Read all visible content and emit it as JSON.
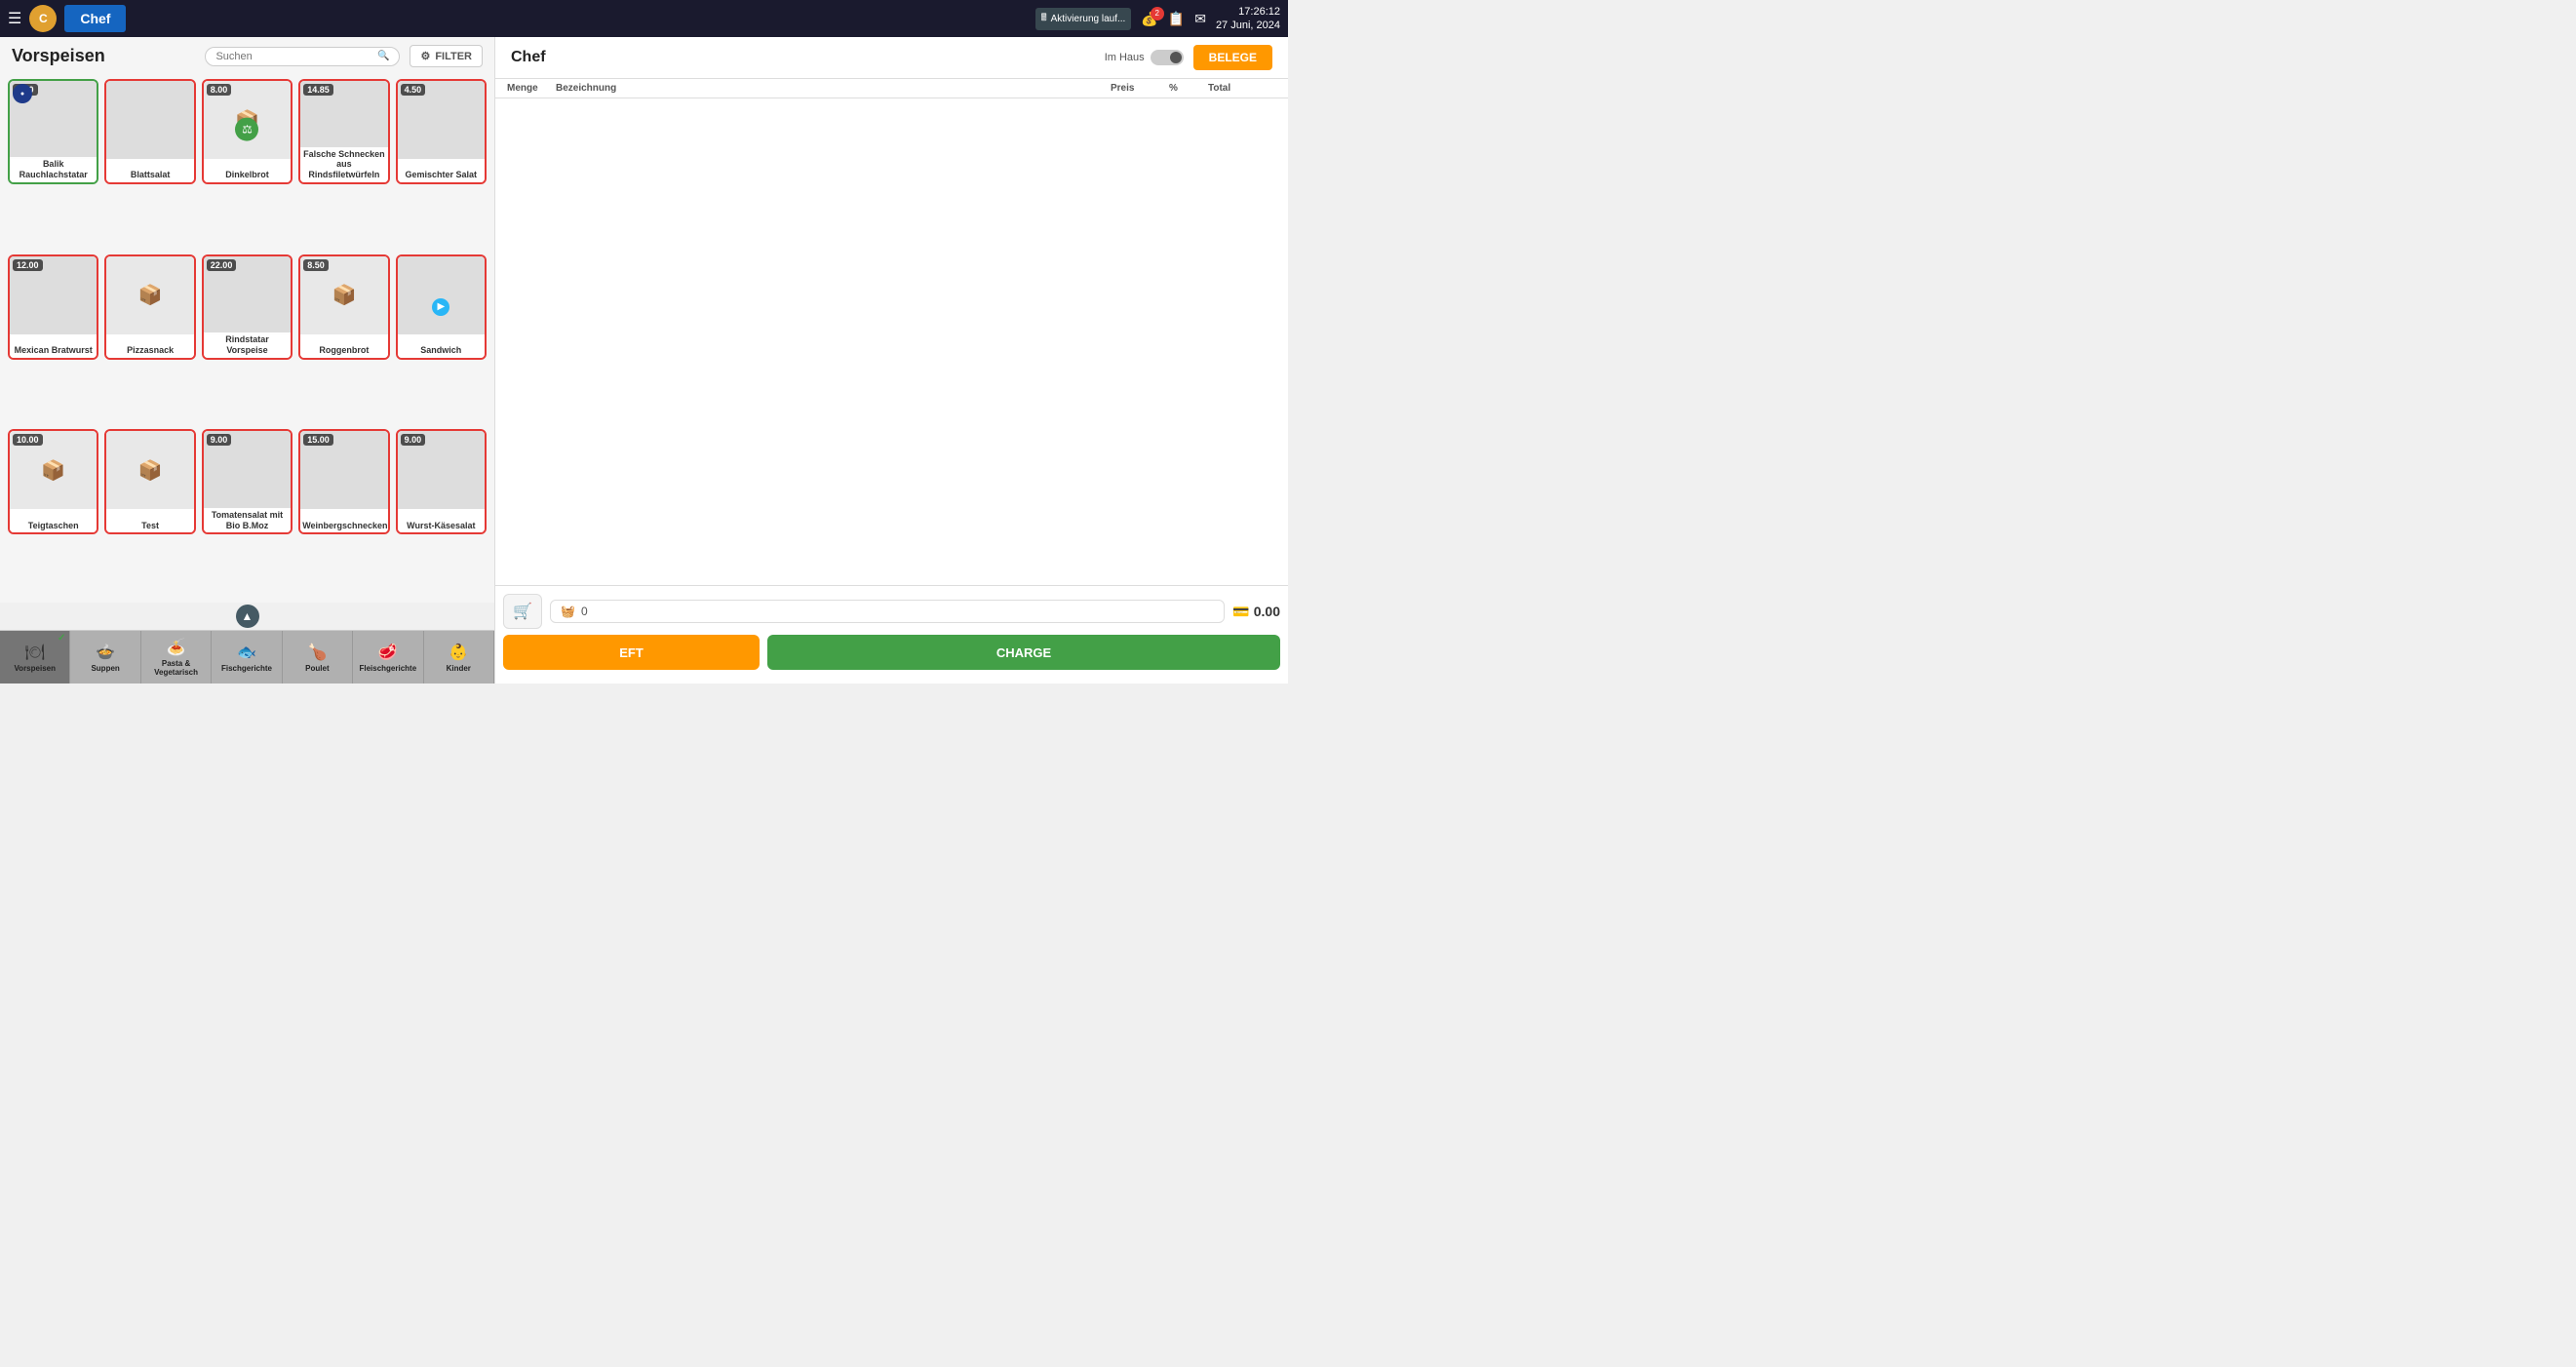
{
  "topbar": {
    "menu_label": "☰",
    "app_title": "Chef",
    "avatar_initials": "C",
    "activation_text": "Aktivierung lauf...",
    "time": "17:26:12",
    "date": "27 Juni, 2024",
    "badge_count": "2"
  },
  "left_panel": {
    "section_title": "Vorspeisen",
    "search_placeholder": "Suchen",
    "filter_label": "FILTER"
  },
  "items": [
    {
      "id": 1,
      "price": "3.10",
      "label": "Balik Rauchlachstatar",
      "has_image": true,
      "img_class": "bg-salmon",
      "border": "blue",
      "has_badge": true,
      "badge": "3.10"
    },
    {
      "id": 2,
      "price": "",
      "label": "Blattsalat",
      "has_image": true,
      "img_class": "bg-green",
      "border": "red"
    },
    {
      "id": 3,
      "price": "8.00",
      "label": "Dinkelbrot",
      "has_image": false,
      "img_class": "",
      "border": "red",
      "has_green_icon": true
    },
    {
      "id": 4,
      "price": "14.85",
      "label": "Falsche Schnecken aus Rindsfiletwürfeln",
      "has_image": true,
      "img_class": "bg-dark",
      "border": "red"
    },
    {
      "id": 5,
      "price": "4.50",
      "label": "Gemischter Salat",
      "has_image": true,
      "img_class": "bg-light-green",
      "border": "red"
    },
    {
      "id": 6,
      "price": "12.00",
      "label": "Mexican Bratwurst",
      "has_image": true,
      "img_class": "bg-red-dish",
      "border": "red"
    },
    {
      "id": 7,
      "price": "",
      "label": "Pizzasnack",
      "has_image": false,
      "img_class": "",
      "border": "red"
    },
    {
      "id": 8,
      "price": "22.00",
      "label": "Rindstatar Vorspeise",
      "has_image": true,
      "img_class": "bg-brown",
      "border": "red"
    },
    {
      "id": 9,
      "price": "8.50",
      "label": "Roggenbrot",
      "has_image": false,
      "img_class": "",
      "border": "red"
    },
    {
      "id": 10,
      "price": "",
      "label": "Sandwich",
      "has_image": true,
      "img_class": "bg-sandwich",
      "border": "red",
      "has_blue_dot": true
    },
    {
      "id": 11,
      "price": "10.00",
      "label": "Teigtaschen",
      "has_image": false,
      "img_class": "",
      "border": "red"
    },
    {
      "id": 12,
      "price": "",
      "label": "Test",
      "has_image": false,
      "img_class": "",
      "border": "red"
    },
    {
      "id": 13,
      "price": "9.00",
      "label": "Tomatensalat mit Bio B.Moz",
      "has_image": true,
      "img_class": "bg-orange",
      "border": "red"
    },
    {
      "id": 14,
      "price": "15.00",
      "label": "Weinbergschnecken",
      "has_image": true,
      "img_class": "bg-dark",
      "border": "red"
    },
    {
      "id": 15,
      "price": "9.00",
      "label": "Wurst-Käsesalat",
      "has_image": true,
      "img_class": "bg-green",
      "border": "red"
    }
  ],
  "categories": [
    {
      "id": "vorspeisen",
      "label": "Vorspeisen",
      "icon": "🍽",
      "active": true,
      "checked": true
    },
    {
      "id": "suppen",
      "label": "Suppen",
      "icon": "🍲",
      "active": false
    },
    {
      "id": "pasta",
      "label": "Pasta & Vegetarisch",
      "icon": "🍝",
      "active": false
    },
    {
      "id": "fischgerichte",
      "label": "Fischgerichte",
      "icon": "🐟",
      "active": false
    },
    {
      "id": "poulet",
      "label": "Poulet",
      "icon": "🍗",
      "active": false
    },
    {
      "id": "fleischgerichte",
      "label": "Fleischgerichte",
      "icon": "🥩",
      "active": false
    },
    {
      "id": "kinder",
      "label": "Kinder",
      "icon": "👶",
      "active": false
    }
  ],
  "right_panel": {
    "title": "Chef",
    "toggle_label": "Im Haus",
    "belege_label": "BELEGE",
    "table_headers": [
      "Menge",
      "Bezeichnung",
      "Preis",
      "%",
      "Total"
    ],
    "cart_count": "0",
    "cart_total": "0.00",
    "eft_label": "EFT",
    "charge_label": "CHARGE"
  }
}
